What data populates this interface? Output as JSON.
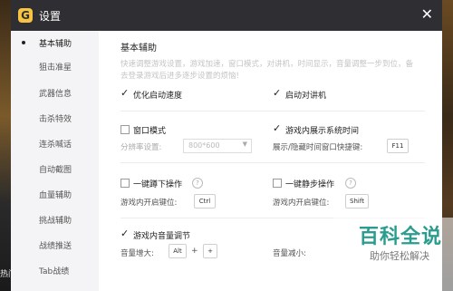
{
  "window": {
    "title": "设置",
    "logo_glyph": "G"
  },
  "sidebar": {
    "items": [
      {
        "label": "基本辅助",
        "active": true
      },
      {
        "label": "狙击准星"
      },
      {
        "label": "武器信息"
      },
      {
        "label": "击杀特效"
      },
      {
        "label": "连杀喊话"
      },
      {
        "label": "自动截图"
      },
      {
        "label": "血量辅助"
      },
      {
        "label": "挑战辅助"
      },
      {
        "label": "战绩推送"
      },
      {
        "label": "Tab战绩"
      }
    ]
  },
  "content": {
    "section_title": "基本辅助",
    "description": "快速调整游戏设置，游戏加速，窗口模式，对讲机，时间显示，音量调整一步到位，备去登录游戏后进多逐步设置的烦恼!",
    "options": {
      "optimize_speed": {
        "label": "优化启动速度",
        "checked": true
      },
      "enable_walkie": {
        "label": "启动对讲机",
        "checked": true
      },
      "window_mode": {
        "label": "窗口模式",
        "checked": false
      },
      "resolution_label": "分辨率设置:",
      "resolution_value": "800*600",
      "show_sys_time": {
        "label": "游戏内展示系统时间",
        "checked": true
      },
      "show_hide_time_label": "展示/隐藏时间窗口快捷键:",
      "show_hide_time_key": "F11",
      "one_key_kick": {
        "label": "一键蹲下操作",
        "checked": false
      },
      "kick_hotkey_label": "游戏内开启键位:",
      "kick_hotkey": "Ctrl",
      "one_key_quiet": {
        "label": "一键静步操作",
        "checked": false
      },
      "quiet_hotkey_label": "游戏内开启键位:",
      "quiet_hotkey": "Shift",
      "volume_adjust": {
        "label": "游戏内音量调节",
        "checked": true
      },
      "volume_up_label": "音量增大:",
      "volume_up_key1": "Alt",
      "volume_up_plus": "+",
      "volume_up_key2": "+",
      "volume_down_label": "音量减小:"
    },
    "help_glyph": "?"
  },
  "watermark": {
    "title": "百科全说",
    "subtitle": "助你轻松解决"
  },
  "background_fragment": "热门"
}
